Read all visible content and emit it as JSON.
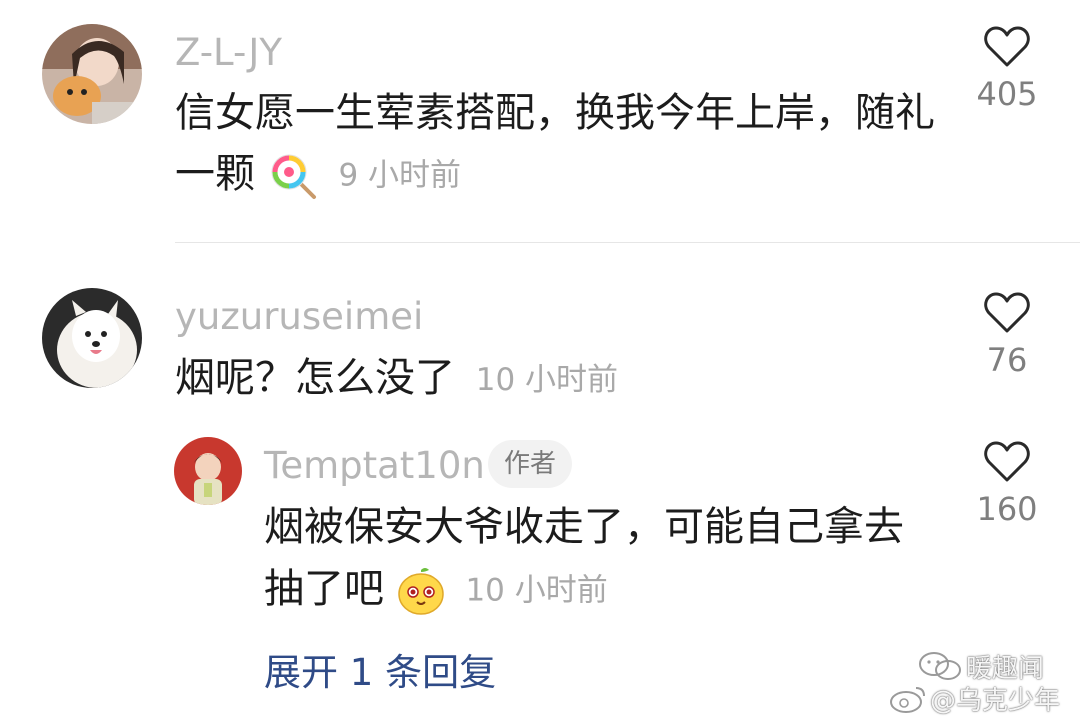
{
  "comments": [
    {
      "username": "Z-L-JY",
      "text_line1": "信女愿一生荤素搭配，换我今年上岸，随礼",
      "text_line2": "一颗",
      "emoji": "lollipop-emoji",
      "time": "9 小时前",
      "likes": "405"
    },
    {
      "username": "yuzuruseimei",
      "text_line1": "烟呢？怎么没了",
      "time": "10 小时前",
      "likes": "76",
      "replies": [
        {
          "username": "Temptat10n",
          "badge": "作者",
          "text_line1": "烟被保安大爷收走了，可能自己拿去",
          "text_line2": "抽了吧",
          "emoji": "mango-face-emoji",
          "time": "10 小时前",
          "likes": "160"
        }
      ],
      "expand_label": "展开 1 条回复"
    }
  ],
  "watermark": {
    "line1": "暖趣闻",
    "line2": "@乌克少年"
  },
  "colors": {
    "username": "#b6b6b6",
    "text": "#1c1c1c",
    "time": "#a9a9a9",
    "link": "#2f4b87",
    "badge_bg": "#f2f2f2"
  }
}
